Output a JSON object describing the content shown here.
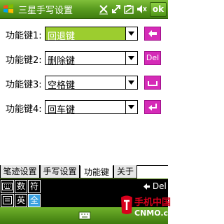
{
  "window": {
    "title": "三星手写设置",
    "ok_label": "ok"
  },
  "rows": [
    {
      "label": "功能键1:",
      "value": "回退键",
      "key_icon": "backspace-arrow-icon"
    },
    {
      "label": "功能键2:",
      "value": "删除键",
      "key_label": "Del"
    },
    {
      "label": "功能键3:",
      "value": "空格键",
      "key_icon": "space-icon"
    },
    {
      "label": "功能键4:",
      "value": "回车键",
      "key_icon": "enter-icon"
    }
  ],
  "tabs": [
    "笔迹设置",
    "手写设置",
    "功能键",
    "关于"
  ],
  "active_tab": "功能键",
  "input_bar": {
    "row1": [
      "数",
      "符"
    ],
    "row2": [
      "英",
      "全"
    ],
    "del_label": "Del"
  },
  "watermark": {
    "brand": "手机中国",
    "site": "CNMO.com"
  },
  "colors": {
    "accent_green": "#5c9e21",
    "key_magenta": "#d52bb7",
    "selected_fill": "#9ccd2f",
    "active_blue": "#3aa1e0"
  }
}
